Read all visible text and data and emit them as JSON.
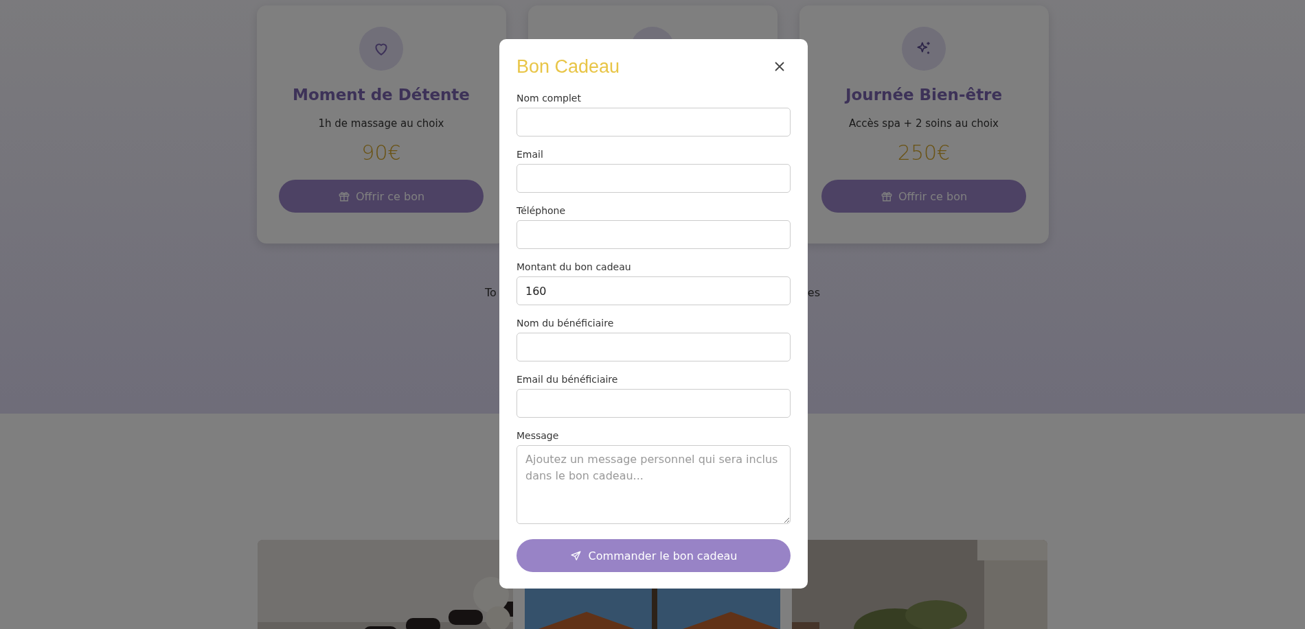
{
  "cards": [
    {
      "title": "Moment de Détente",
      "description": "1h de massage au choix",
      "price": "90€",
      "button": "Offrir ce bon"
    },
    {
      "title": "Journée Bien-être",
      "description": "Accès spa + 2 soins au choix",
      "price": "250€",
      "button": "Offrir ce bon"
    }
  ],
  "note": {
    "left_fragment": "To",
    "right_fragment": "es"
  },
  "modal": {
    "title": "Bon Cadeau",
    "fields": [
      {
        "label": "Nom complet",
        "kind": "input"
      },
      {
        "label": "Email",
        "kind": "input"
      },
      {
        "label": "Téléphone",
        "kind": "input"
      },
      {
        "label": "Montant du bon cadeau",
        "kind": "input",
        "value": "160"
      },
      {
        "label": "Nom du bénéficiaire",
        "kind": "input"
      },
      {
        "label": "Email du bénéficiaire",
        "kind": "input"
      },
      {
        "label": "Message",
        "kind": "textarea",
        "placeholder": "Ajoutez un message personnel qui sera inclus dans le bon cadeau..."
      }
    ],
    "submit": "Commander le bon cadeau"
  }
}
